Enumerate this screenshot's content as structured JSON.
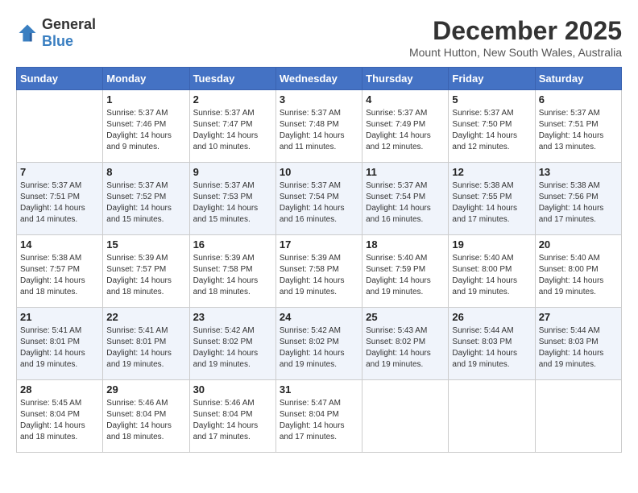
{
  "logo": {
    "general": "General",
    "blue": "Blue"
  },
  "title": "December 2025",
  "location": "Mount Hutton, New South Wales, Australia",
  "weekdays": [
    "Sunday",
    "Monday",
    "Tuesday",
    "Wednesday",
    "Thursday",
    "Friday",
    "Saturday"
  ],
  "weeks": [
    [
      {
        "day": "",
        "sunrise": "",
        "sunset": "",
        "daylight": ""
      },
      {
        "day": "1",
        "sunrise": "Sunrise: 5:37 AM",
        "sunset": "Sunset: 7:46 PM",
        "daylight": "Daylight: 14 hours and 9 minutes."
      },
      {
        "day": "2",
        "sunrise": "Sunrise: 5:37 AM",
        "sunset": "Sunset: 7:47 PM",
        "daylight": "Daylight: 14 hours and 10 minutes."
      },
      {
        "day": "3",
        "sunrise": "Sunrise: 5:37 AM",
        "sunset": "Sunset: 7:48 PM",
        "daylight": "Daylight: 14 hours and 11 minutes."
      },
      {
        "day": "4",
        "sunrise": "Sunrise: 5:37 AM",
        "sunset": "Sunset: 7:49 PM",
        "daylight": "Daylight: 14 hours and 12 minutes."
      },
      {
        "day": "5",
        "sunrise": "Sunrise: 5:37 AM",
        "sunset": "Sunset: 7:50 PM",
        "daylight": "Daylight: 14 hours and 12 minutes."
      },
      {
        "day": "6",
        "sunrise": "Sunrise: 5:37 AM",
        "sunset": "Sunset: 7:51 PM",
        "daylight": "Daylight: 14 hours and 13 minutes."
      }
    ],
    [
      {
        "day": "7",
        "sunrise": "Sunrise: 5:37 AM",
        "sunset": "Sunset: 7:51 PM",
        "daylight": "Daylight: 14 hours and 14 minutes."
      },
      {
        "day": "8",
        "sunrise": "Sunrise: 5:37 AM",
        "sunset": "Sunset: 7:52 PM",
        "daylight": "Daylight: 14 hours and 15 minutes."
      },
      {
        "day": "9",
        "sunrise": "Sunrise: 5:37 AM",
        "sunset": "Sunset: 7:53 PM",
        "daylight": "Daylight: 14 hours and 15 minutes."
      },
      {
        "day": "10",
        "sunrise": "Sunrise: 5:37 AM",
        "sunset": "Sunset: 7:54 PM",
        "daylight": "Daylight: 14 hours and 16 minutes."
      },
      {
        "day": "11",
        "sunrise": "Sunrise: 5:37 AM",
        "sunset": "Sunset: 7:54 PM",
        "daylight": "Daylight: 14 hours and 16 minutes."
      },
      {
        "day": "12",
        "sunrise": "Sunrise: 5:38 AM",
        "sunset": "Sunset: 7:55 PM",
        "daylight": "Daylight: 14 hours and 17 minutes."
      },
      {
        "day": "13",
        "sunrise": "Sunrise: 5:38 AM",
        "sunset": "Sunset: 7:56 PM",
        "daylight": "Daylight: 14 hours and 17 minutes."
      }
    ],
    [
      {
        "day": "14",
        "sunrise": "Sunrise: 5:38 AM",
        "sunset": "Sunset: 7:57 PM",
        "daylight": "Daylight: 14 hours and 18 minutes."
      },
      {
        "day": "15",
        "sunrise": "Sunrise: 5:39 AM",
        "sunset": "Sunset: 7:57 PM",
        "daylight": "Daylight: 14 hours and 18 minutes."
      },
      {
        "day": "16",
        "sunrise": "Sunrise: 5:39 AM",
        "sunset": "Sunset: 7:58 PM",
        "daylight": "Daylight: 14 hours and 18 minutes."
      },
      {
        "day": "17",
        "sunrise": "Sunrise: 5:39 AM",
        "sunset": "Sunset: 7:58 PM",
        "daylight": "Daylight: 14 hours and 19 minutes."
      },
      {
        "day": "18",
        "sunrise": "Sunrise: 5:40 AM",
        "sunset": "Sunset: 7:59 PM",
        "daylight": "Daylight: 14 hours and 19 minutes."
      },
      {
        "day": "19",
        "sunrise": "Sunrise: 5:40 AM",
        "sunset": "Sunset: 8:00 PM",
        "daylight": "Daylight: 14 hours and 19 minutes."
      },
      {
        "day": "20",
        "sunrise": "Sunrise: 5:40 AM",
        "sunset": "Sunset: 8:00 PM",
        "daylight": "Daylight: 14 hours and 19 minutes."
      }
    ],
    [
      {
        "day": "21",
        "sunrise": "Sunrise: 5:41 AM",
        "sunset": "Sunset: 8:01 PM",
        "daylight": "Daylight: 14 hours and 19 minutes."
      },
      {
        "day": "22",
        "sunrise": "Sunrise: 5:41 AM",
        "sunset": "Sunset: 8:01 PM",
        "daylight": "Daylight: 14 hours and 19 minutes."
      },
      {
        "day": "23",
        "sunrise": "Sunrise: 5:42 AM",
        "sunset": "Sunset: 8:02 PM",
        "daylight": "Daylight: 14 hours and 19 minutes."
      },
      {
        "day": "24",
        "sunrise": "Sunrise: 5:42 AM",
        "sunset": "Sunset: 8:02 PM",
        "daylight": "Daylight: 14 hours and 19 minutes."
      },
      {
        "day": "25",
        "sunrise": "Sunrise: 5:43 AM",
        "sunset": "Sunset: 8:02 PM",
        "daylight": "Daylight: 14 hours and 19 minutes."
      },
      {
        "day": "26",
        "sunrise": "Sunrise: 5:44 AM",
        "sunset": "Sunset: 8:03 PM",
        "daylight": "Daylight: 14 hours and 19 minutes."
      },
      {
        "day": "27",
        "sunrise": "Sunrise: 5:44 AM",
        "sunset": "Sunset: 8:03 PM",
        "daylight": "Daylight: 14 hours and 19 minutes."
      }
    ],
    [
      {
        "day": "28",
        "sunrise": "Sunrise: 5:45 AM",
        "sunset": "Sunset: 8:04 PM",
        "daylight": "Daylight: 14 hours and 18 minutes."
      },
      {
        "day": "29",
        "sunrise": "Sunrise: 5:46 AM",
        "sunset": "Sunset: 8:04 PM",
        "daylight": "Daylight: 14 hours and 18 minutes."
      },
      {
        "day": "30",
        "sunrise": "Sunrise: 5:46 AM",
        "sunset": "Sunset: 8:04 PM",
        "daylight": "Daylight: 14 hours and 17 minutes."
      },
      {
        "day": "31",
        "sunrise": "Sunrise: 5:47 AM",
        "sunset": "Sunset: 8:04 PM",
        "daylight": "Daylight: 14 hours and 17 minutes."
      },
      {
        "day": "",
        "sunrise": "",
        "sunset": "",
        "daylight": ""
      },
      {
        "day": "",
        "sunrise": "",
        "sunset": "",
        "daylight": ""
      },
      {
        "day": "",
        "sunrise": "",
        "sunset": "",
        "daylight": ""
      }
    ]
  ]
}
